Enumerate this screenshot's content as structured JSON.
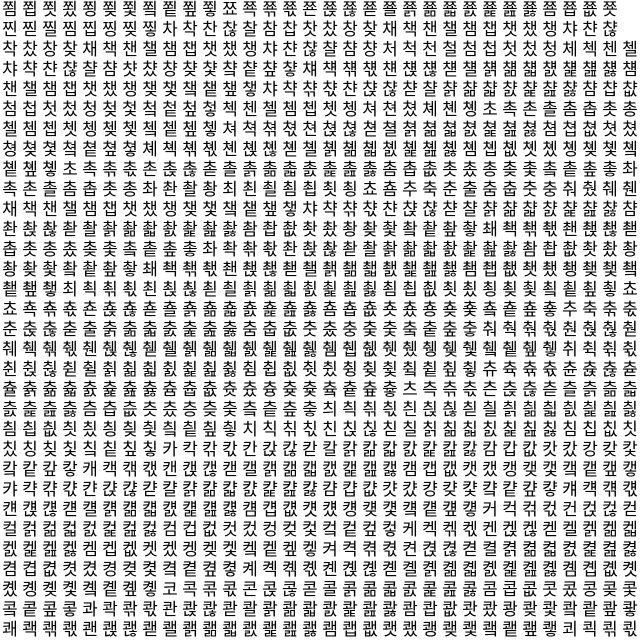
{
  "rows": [
    "쬠쬡쬣쬤쬥쬦쬧쬨쬩쬪쬫쬬쬭쬮쬯쬰쬱쬲쬳쬴쬵쬶쬷쬸쬹쬺쬻쬼쬽쬾쬿",
    "찐찓찔찜찝찡찢찧차착찬찮찰참찹찻찼창찾채책챈챌챔챕챗챘챙챠챤챦",
    "착찼창찾채책챈챌챔챕챗챘챙챠챤챦챨챰챵처척천철첨첩첫첬청체첵첸첼",
    "챠챡챤챦챨챰챳챴챵챶챷챸챹챺챻챼챽챾챿첀첁첂첃첄첅첆첇첈첉첊첋첌",
    "챈챌챔챕챗챘챙챚챛챜챝챞챟챠챡챢챣챤챥챦챧챨챩챪챫챬챭챮챯챰챱챲",
    "첨첩첫첬청첮첯첰첱첲첳첵첸첼쳄쳅쳇쳉쳐쳔쳤쳬쳰촁초촉촌촐촘촙촛총",
    "첼쳄쳅쳇쳉쳊쳋쳌쳍쳎쳏쳐쳑쳒쳓쳔쳕쳖쳗쳘쳙쳚쳛쳜쳝쳞쳟쳠쳡쳢쳣쳤",
    "쳥쳦쳧쳨쳩쳪쳫쳬쳭쳮쳯쳰쳱쳲쳳쳴쳵쳶쳷쳸쳹쳺쳻쳼쳽쳾쳿촀촁촂촃촄",
    "촅촆촇초촉촊촋촌촍촎촏촐촑촒촓촔촕촖촗촘촙촚촛촜총촞촟촠촡촢촣촤",
    "촉촌촐촘촙촛총촤촨촬촹최쵠쵤쵬쵭쵯쵱쵸춈추축춘출춤춥춧충춰췄췌췐",
    "채책챈챌챔챕챗챘챙챚챛챜챝챞챟챠챡챢챣챤챥챦챧챨챩챪챫챬챭챮챯챰",
    "촨촩촪촫촬촭촮촯촰촱촲촳촴촵촶촷촸촹촺촻촼촽촾촿쵀쵁쵂쵃쵄쵅쵆쵇",
    "촙촛총촜촞촟촠촡촢촣촤촥촦촧촨촩촪촫촬촭촮촯촰촱촲촳촴촵촶촷촸촹",
    "촹촺촻촼촽촾촿쵀쵁쵂쵃쵄쵅쵆쵇쵈쵉쵊쵋쵌쵍쵎쵏쵐쵑쵒쵓쵔쵕쵖쵗쵘",
    "쵙쵚쵛최쵝쵞쵟쵠쵡쵢쵣쵤쵥쵦쵧쵨쵩쵪쵫쵬쵭쵮쵯쵰쵱쵲쵳쵴쵵쵶쵷쵸",
    "쵸쵹쵺쵻쵼쵽쵾쵿춀춁춂춃춄춅춆춇춈춉춊춋춌춍춎춏춐춑춒춓추축춖춗",
    "춘춙춚춛출춝춞춟춠춡춢춣춤춥춦춧춨충춪춫춬춭춮춯춰춱춲춳춴춵춶춷",
    "췌췍췎췏췐췑췒췓췔췕췖췗췘췙췚췛췜췝췞췟췠췡췢췣췤췥췦췧취췩췪췫",
    "췬췭췮췯췰췱췲췳췴췵췶췷췸췹췺췻췼췽췾췿츀츁츂츃츄츅츆츇츈츉츊츋",
    "츌츍츎츏츐츑츒츓츔츕츖츗츘츙츚츛츜츝츞츟츠측츢츣츤츥츦츧츨츩츪츫",
    "츬츭츮츯츰츱츲츳츴층츶츷츸츹츺츻츼츽츾츿칀칁칂칃칄칅칆칇칈칉칊칋",
    "칌칍칎칏칐칑칒칓칔칕칖칗치칙칚칛친칝칞칟칠칡칢칣칤칥칦칧침칩칪칫",
    "칬칭칮칯칰칱칲칳카칵칶칷칸칹칺칻칼칽칾칿캀캁캂캃캄캅캆캇캈캉캊캋",
    "캌캍캎캏캐캑캒캓캔캕캖캗캘캙캚캛캜캝캞캟캠캡캢캣캤캥캦캧캨캩캪캫",
    "캬캭캮캯캰캱캲캳캴캵캶캷캸캹캺캻캼캽캾캿컀컁컂컃컄컅컆컇컈컉컊컋",
    "컌컍컎컏컐컑컒컓컔컕컖컗컘컙컚컛컜컝컞컟컠컡컢컣커컥컦컧컨컩컪컫",
    "컬컭컮컯컰컱컲컳컴컵컶컷컸컹컺컻컼컽컾컿케켁켂켃켄켅켆켇켈켉켊켋",
    "켌켍켎켏켐켑켒켓켔켕켖켗켘켙켚켛켜켝켞켟켠켡켢켣켤켥켦켧켨켩켪켫",
    "켬켭켮켯켰켱켲켳켴켵켶켷켸켹켺켻켼켽켾켿콀콁콂콃콄콅콆콇콈콉콊콋",
    "콌콍콎콏콐콑콒콓코콕콖콗콘콙콚콛콜콝콞콟콠콡콢콣콤콥콦콧콨콩콪콫",
    "콬콭콮콯콰콱콲콳콴콵콶콷콸콹콺콻콼콽콾콿쾀쾁쾂쾃쾄쾅쾆쾇쾈쾉쾊쾋",
    "쾌쾍쾎쾏쾐쾑쾒쾓쾔쾕쾖쾗쾘쾙쾚쾛쾜쾝쾞쾟쾠쾡쾢쾣쾤쾥쾦쾧쾨쾩쾪쾫"
  ]
}
